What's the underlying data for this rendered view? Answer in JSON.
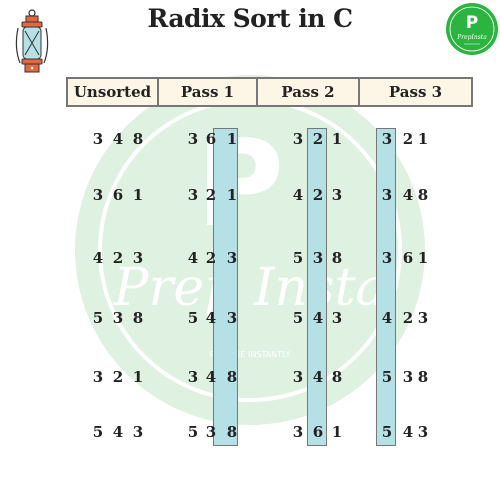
{
  "title": "Radix Sort in C",
  "icons": {
    "left": "lantern-icon",
    "right": "prepinsta-logo"
  },
  "logo": {
    "letter": "P",
    "text": "PrepInsta"
  },
  "watermark": {
    "letter": "P",
    "brand": "Prep Insta",
    "tagline": "PREPARE INSTANTLY"
  },
  "colors": {
    "header_bg": "#fdf5e6",
    "highlight": "#b5e0e6",
    "watermark": "#dff1e0",
    "logo_green": "#2bb540",
    "lantern_orange": "#e5673f",
    "lantern_glass": "#b5e0e6"
  },
  "columns": [
    {
      "label": "Unsorted",
      "highlight_digit": null,
      "rows": [
        "348",
        "361",
        "423",
        "538",
        "321",
        "543"
      ]
    },
    {
      "label": "Pass 1",
      "highlight_digit": 2,
      "rows": [
        "361",
        "321",
        "423",
        "543",
        "348",
        "538"
      ]
    },
    {
      "label": "Pass 2",
      "highlight_digit": 1,
      "rows": [
        "321",
        "423",
        "538",
        "543",
        "348",
        "361"
      ]
    },
    {
      "label": "Pass 3",
      "highlight_digit": 0,
      "rows": [
        "321",
        "348",
        "361",
        "423",
        "538",
        "543"
      ]
    }
  ]
}
